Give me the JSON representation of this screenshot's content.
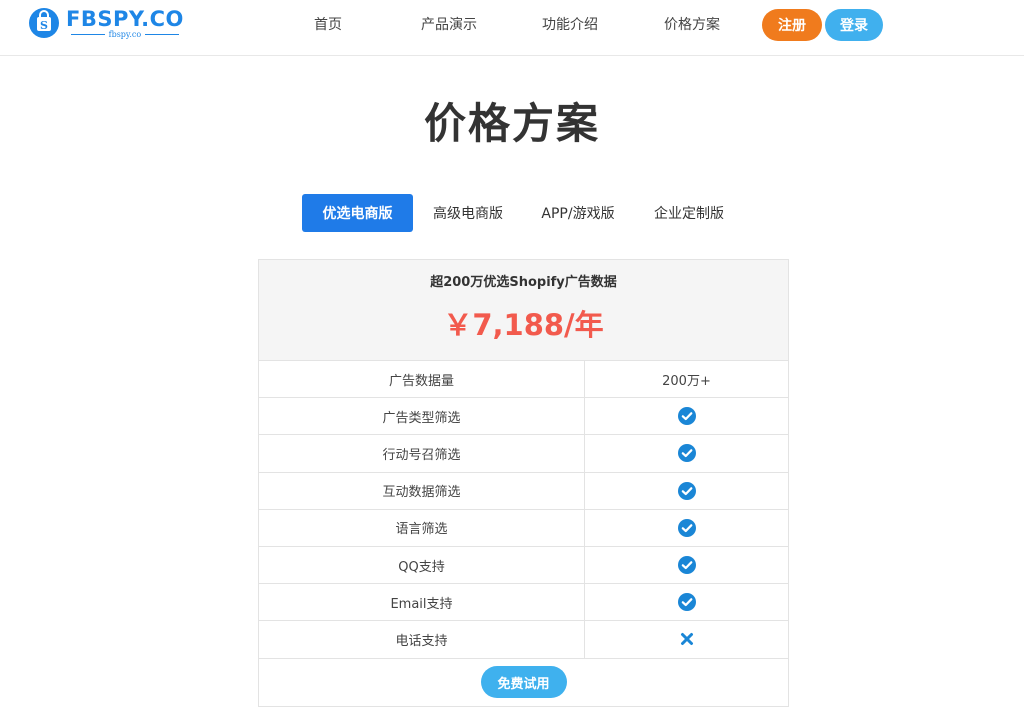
{
  "brand": {
    "name": "FBSPY.CO",
    "domain": "fbspy.co",
    "color": "#1e86e6"
  },
  "nav": {
    "home": "首页",
    "demo": "产品演示",
    "features": "功能介绍",
    "pricing": "价格方案",
    "register": "注册",
    "login": "登录"
  },
  "page": {
    "title": "价格方案"
  },
  "tabs": [
    {
      "label": "优选电商版",
      "active": true
    },
    {
      "label": "高级电商版",
      "active": false
    },
    {
      "label": "APP/游戏版",
      "active": false
    },
    {
      "label": "企业定制版",
      "active": false
    }
  ],
  "plan": {
    "subtitle": "超200万优选Shopify广告数据",
    "price": "￥7,188/年",
    "price_color": "#f25a4d",
    "rows": [
      {
        "label": "广告数据量",
        "value": "200万+"
      },
      {
        "label": "广告类型筛选",
        "icon": "check-circle-icon"
      },
      {
        "label": "行动号召筛选",
        "icon": "check-circle-icon"
      },
      {
        "label": "互动数据筛选",
        "icon": "check-circle-icon"
      },
      {
        "label": "语言筛选",
        "icon": "check-circle-icon"
      },
      {
        "label": "QQ支持",
        "icon": "check-circle-icon"
      },
      {
        "label": "Email支持",
        "icon": "check-circle-icon"
      },
      {
        "label": "电话支持",
        "icon": "cross-icon"
      }
    ],
    "cta": "免费试用"
  },
  "colors": {
    "register_button": "#f07b1d",
    "login_button": "#40b0ee",
    "active_tab": "#1f7be8",
    "check_icon": "#1a86d6",
    "trial_button": "#3fb1ee"
  }
}
